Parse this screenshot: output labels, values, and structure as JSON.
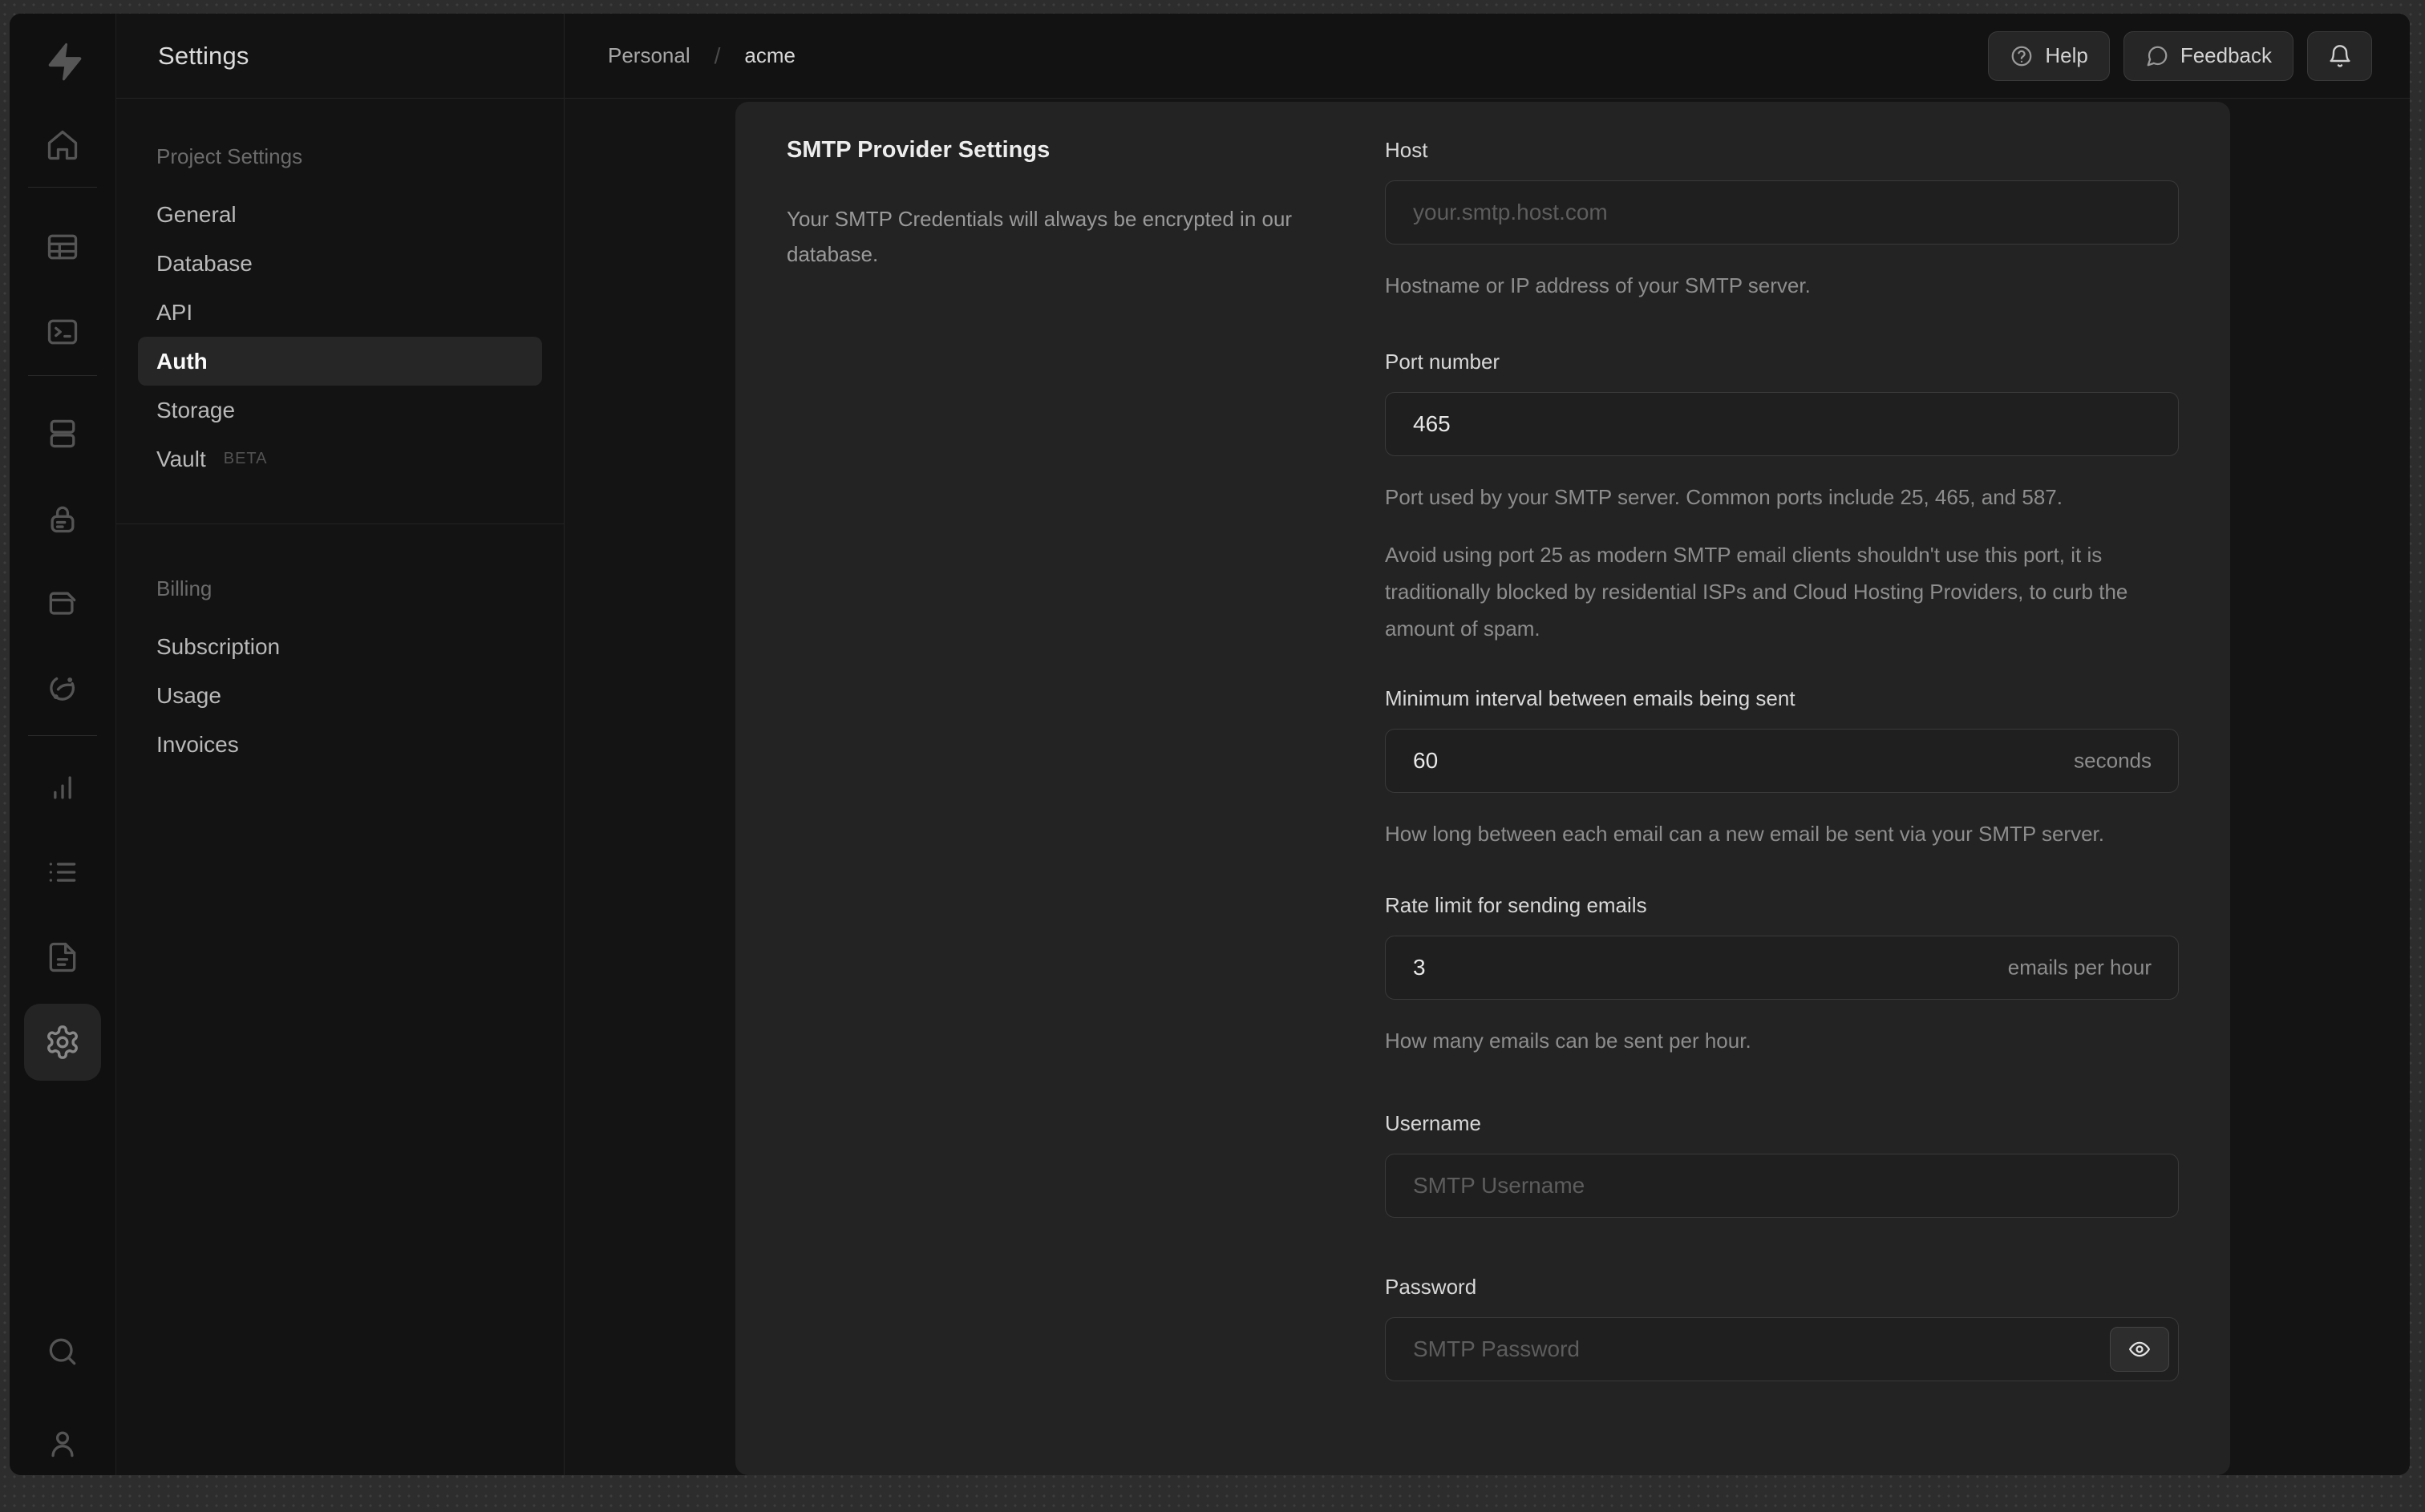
{
  "colors": {
    "backdrop": "#2d2d2d",
    "window_bg": "#121212",
    "card_bg": "#232323",
    "input_bg": "#1f1f1f",
    "border": "#242424",
    "active_pill_bg": "#262626",
    "text_primary": "#e8e8e8",
    "text_secondary": "#9a9a9a",
    "text_muted": "#6b6b6b"
  },
  "rail": {
    "logo": "supabase-logo",
    "icons": [
      "home",
      "table-editor",
      "sql-editor",
      "database",
      "authentication",
      "storage",
      "edge-functions",
      "reports",
      "logs",
      "api-docs",
      "settings",
      "search",
      "account"
    ],
    "selected": "settings"
  },
  "sidebar": {
    "title": "Settings",
    "sections": [
      {
        "heading": "Project Settings",
        "items": [
          {
            "label": "General"
          },
          {
            "label": "Database"
          },
          {
            "label": "API"
          },
          {
            "label": "Auth",
            "active": true
          },
          {
            "label": "Storage"
          },
          {
            "label": "Vault",
            "badge": "BETA"
          }
        ]
      },
      {
        "heading": "Billing",
        "items": [
          {
            "label": "Subscription"
          },
          {
            "label": "Usage"
          },
          {
            "label": "Invoices"
          }
        ]
      }
    ]
  },
  "topbar": {
    "breadcrumb": {
      "org": "Personal",
      "separator": "/",
      "project": "acme"
    },
    "help_label": "Help",
    "feedback_label": "Feedback"
  },
  "panel": {
    "title": "SMTP Provider Settings",
    "description": "Your SMTP Credentials will always be encrypted in our database."
  },
  "form": {
    "fields": [
      {
        "label": "Host",
        "placeholder": "your.smtp.host.com",
        "helpers": [
          "Hostname or IP address of your SMTP server."
        ]
      },
      {
        "label": "Port number",
        "value": "465",
        "helpers": [
          "Port used by your SMTP server. Common ports include 25, 465, and 587.",
          "Avoid using port 25 as modern SMTP email clients shouldn't use this port, it is traditionally blocked by residential ISPs and Cloud Hosting Providers, to curb the amount of spam."
        ]
      },
      {
        "label": "Minimum interval between emails being sent",
        "value": "60",
        "suffix": "seconds",
        "helpers": [
          "How long between each email can a new email be sent via your SMTP server."
        ]
      },
      {
        "label": "Rate limit for sending emails",
        "value": "3",
        "suffix": "emails per hour",
        "helpers": [
          "How many emails can be sent per hour."
        ]
      },
      {
        "label": "Username",
        "placeholder": "SMTP Username",
        "helpers": []
      },
      {
        "label": "Password",
        "placeholder": "SMTP Password",
        "helpers": [],
        "action": "reveal-password"
      }
    ]
  }
}
